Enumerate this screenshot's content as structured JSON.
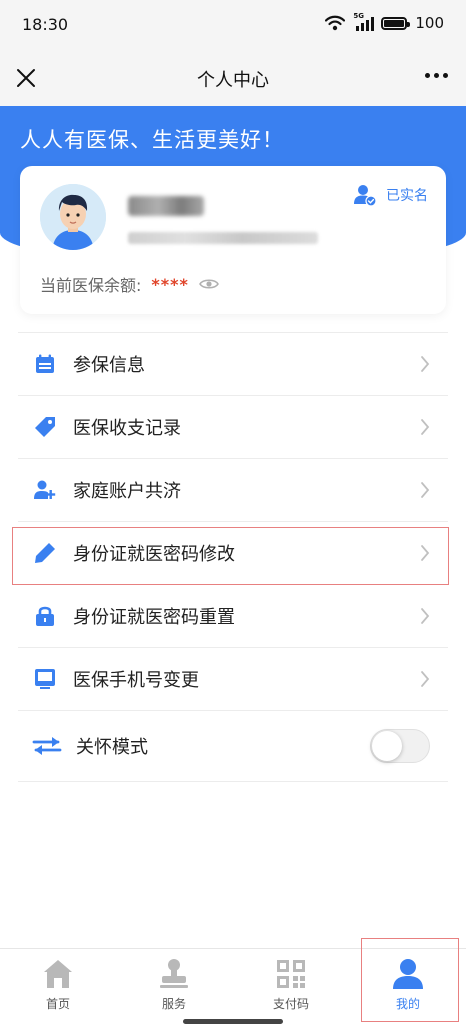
{
  "status_bar": {
    "time": "18:30",
    "network": "5G",
    "battery": "100"
  },
  "nav": {
    "title": "个人中心"
  },
  "hero": {
    "slogan": "人人有医保、生活更美好！"
  },
  "profile": {
    "verified_label": "已实名",
    "balance_label": "当前医保余额:",
    "balance_value": "****"
  },
  "menu": {
    "items": [
      {
        "label": "参保信息",
        "icon": "calendar-icon"
      },
      {
        "label": "医保收支记录",
        "icon": "tag-icon"
      },
      {
        "label": "家庭账户共济",
        "icon": "add-user-icon"
      },
      {
        "label": "身份证就医密码修改",
        "icon": "pencil-icon"
      },
      {
        "label": "身份证就医密码重置",
        "icon": "lock-icon"
      },
      {
        "label": "医保手机号变更",
        "icon": "monitor-icon"
      }
    ],
    "care_mode": {
      "label": "关怀模式",
      "icon": "swap-arrows-icon",
      "enabled": false
    }
  },
  "tabs": [
    {
      "label": "首页",
      "icon": "home-icon",
      "active": false
    },
    {
      "label": "服务",
      "icon": "stamp-icon",
      "active": false
    },
    {
      "label": "支付码",
      "icon": "qr-code-icon",
      "active": false
    },
    {
      "label": "我的",
      "icon": "user-icon",
      "active": true
    }
  ],
  "colors": {
    "primary": "#3a80f0",
    "balance": "#e0452b",
    "highlight": "#e88080"
  }
}
